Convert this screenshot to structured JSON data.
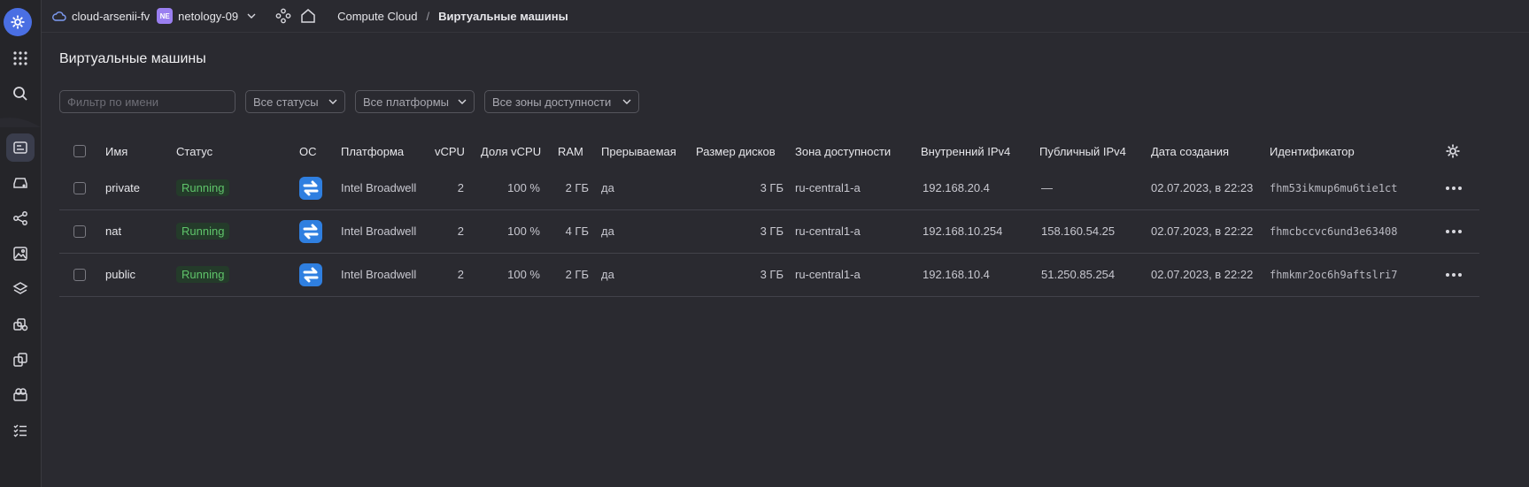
{
  "topbar": {
    "cloud_name": "cloud-arsenii-fv",
    "folder_badge": "NE",
    "folder_name": "netology-09",
    "breadcrumb_service": "Compute Cloud",
    "breadcrumb_sep": "/",
    "breadcrumb_current": "Виртуальные машины"
  },
  "page": {
    "title": "Виртуальные машины"
  },
  "filters": {
    "name_placeholder": "Фильтр по имени",
    "status": "Все статусы",
    "platform": "Все платформы",
    "zone": "Все зоны доступности"
  },
  "table": {
    "columns": [
      "Имя",
      "Статус",
      "ОС",
      "Платформа",
      "vCPU",
      "Доля vCPU",
      "RAM",
      "Прерываемая",
      "Размер дисков",
      "Зона доступности",
      "Внутренний IPv4",
      "Публичный IPv4",
      "Дата создания",
      "Идентификатор"
    ],
    "rows": [
      {
        "name": "private",
        "status": "Running",
        "platform": "Intel Broadwell",
        "vcpu": "2",
        "vcpu_share": "100 %",
        "ram": "2 ГБ",
        "preemptible": "да",
        "disk": "3 ГБ",
        "zone": "ru-central1-a",
        "internal_ip": "192.168.20.4",
        "public_ip": "—",
        "created": "02.07.2023, в 22:23",
        "id": "fhm53ikmup6mu6tie1ct"
      },
      {
        "name": "nat",
        "status": "Running",
        "platform": "Intel Broadwell",
        "vcpu": "2",
        "vcpu_share": "100 %",
        "ram": "4 ГБ",
        "preemptible": "да",
        "disk": "3 ГБ",
        "zone": "ru-central1-a",
        "internal_ip": "192.168.10.254",
        "public_ip": "158.160.54.25",
        "created": "02.07.2023, в 22:22",
        "id": "fhmcbccvc6und3e63408"
      },
      {
        "name": "public",
        "status": "Running",
        "platform": "Intel Broadwell",
        "vcpu": "2",
        "vcpu_share": "100 %",
        "ram": "2 ГБ",
        "preemptible": "да",
        "disk": "3 ГБ",
        "zone": "ru-central1-a",
        "internal_ip": "192.168.10.4",
        "public_ip": "51.250.85.254",
        "created": "02.07.2023, в 22:22",
        "id": "fhmkmr2oc6h9aftslri7"
      }
    ]
  },
  "colors": {
    "accent": "#4a6fe3",
    "status_running": "#5fc46a",
    "os_icon": "#2f7fe0"
  }
}
